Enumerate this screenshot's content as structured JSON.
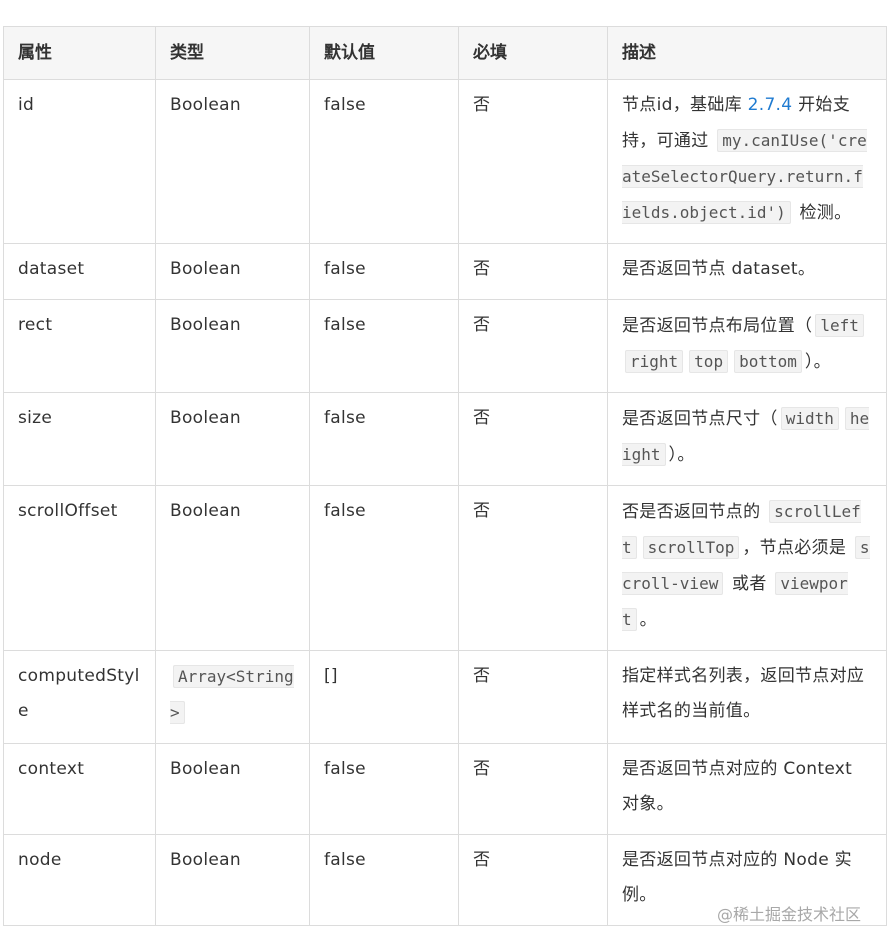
{
  "table": {
    "headers": [
      "属性",
      "类型",
      "默认值",
      "必填",
      "描述"
    ],
    "rows": [
      {
        "name": "id",
        "type": "Boolean",
        "default": "false",
        "required": "否",
        "desc": [
          {
            "t": "text",
            "v": "节点id，基础库 "
          },
          {
            "t": "link",
            "v": "2.7.4"
          },
          {
            "t": "text",
            "v": " 开始支持，可通过 "
          },
          {
            "t": "code",
            "v": "my.canIUse('createSelectorQuery.return.fields.object.id')"
          },
          {
            "t": "text",
            "v": " 检测。"
          }
        ]
      },
      {
        "name": "dataset",
        "type": "Boolean",
        "default": "false",
        "required": "否",
        "desc": [
          {
            "t": "text",
            "v": "是否返回节点 dataset。"
          }
        ]
      },
      {
        "name": "rect",
        "type": "Boolean",
        "default": "false",
        "required": "否",
        "desc": [
          {
            "t": "text",
            "v": "是否返回节点布局位置（"
          },
          {
            "t": "code",
            "v": "left"
          },
          {
            "t": "code",
            "v": "right"
          },
          {
            "t": "code",
            "v": "top"
          },
          {
            "t": "code",
            "v": "bottom"
          },
          {
            "t": "text",
            "v": "）。"
          }
        ]
      },
      {
        "name": "size",
        "type": "Boolean",
        "default": "false",
        "required": "否",
        "desc": [
          {
            "t": "text",
            "v": "是否返回节点尺寸（"
          },
          {
            "t": "code",
            "v": "width"
          },
          {
            "t": "code",
            "v": "height"
          },
          {
            "t": "text",
            "v": "）。"
          }
        ]
      },
      {
        "name": "scrollOffset",
        "type": "Boolean",
        "default": "false",
        "required": "否",
        "desc": [
          {
            "t": "text",
            "v": "否是否返回节点的 "
          },
          {
            "t": "code",
            "v": "scrollLeft"
          },
          {
            "t": "code",
            "v": "scrollTop"
          },
          {
            "t": "text",
            "v": "，节点必须是 "
          },
          {
            "t": "code",
            "v": "scroll-view"
          },
          {
            "t": "text",
            "v": " 或者 "
          },
          {
            "t": "code",
            "v": "viewport"
          },
          {
            "t": "text",
            "v": "。"
          }
        ]
      },
      {
        "name": "computedStyle",
        "typeCode": "Array<String>",
        "default": "[]",
        "required": "否",
        "desc": [
          {
            "t": "text",
            "v": "指定样式名列表，返回节点对应样式名的当前值。"
          }
        ]
      },
      {
        "name": "context",
        "type": "Boolean",
        "default": "false",
        "required": "否",
        "desc": [
          {
            "t": "text",
            "v": "是否返回节点对应的 Context 对象。"
          }
        ]
      },
      {
        "name": "node",
        "type": "Boolean",
        "default": "false",
        "required": "否",
        "desc": [
          {
            "t": "text",
            "v": "是否返回节点对应的 Node 实例。"
          }
        ]
      }
    ]
  },
  "watermark": "@稀土掘金技术社区",
  "colors": {
    "link": "#1f7bd1",
    "header_bg": "#f6f6f6",
    "border": "#dcdcdc",
    "code_bg": "#f3f3f3"
  }
}
